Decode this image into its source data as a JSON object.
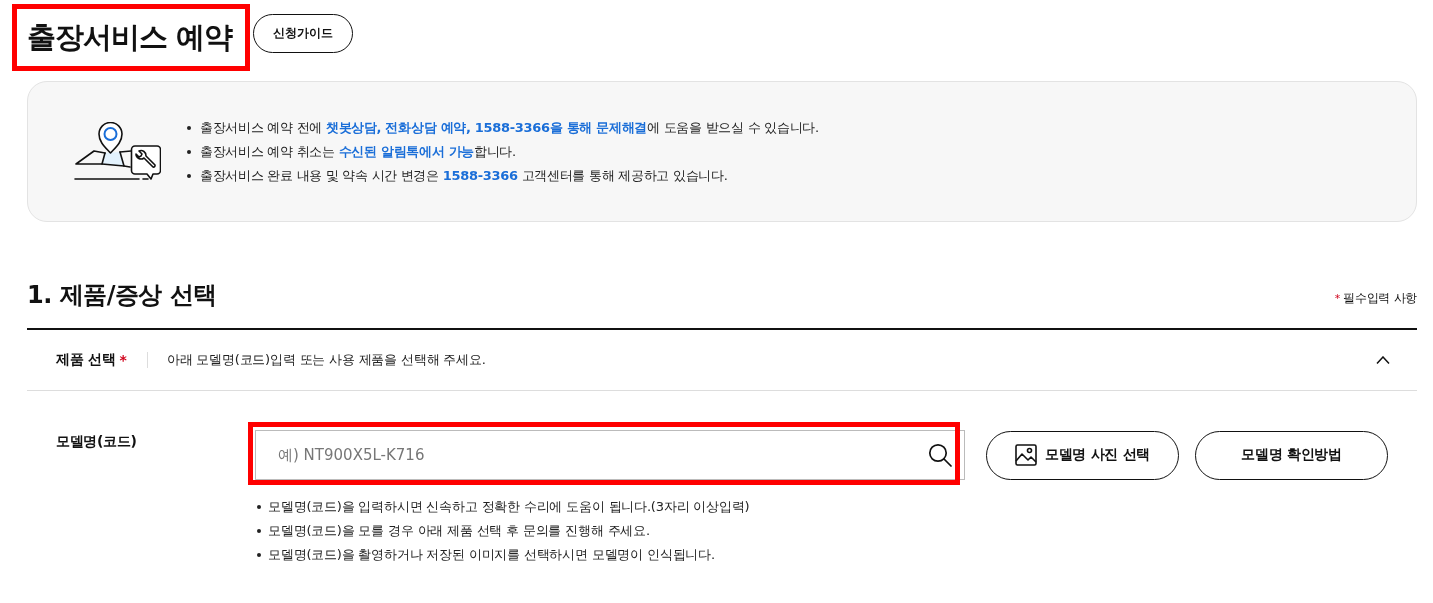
{
  "header": {
    "title": "출장서비스 예약",
    "highlighted": true,
    "guide_button": "신청가이드"
  },
  "notice": {
    "items": [
      "출장서비스 예약 전에 **챗봇상담, 전화상담 예약, 1588-3366을 통해 문제해결**에 도움을 받으실 수 있습니다.",
      "출장서비스 예약 취소는 **수신된 알림톡에서 가능**합니다.",
      "출장서비스 완료 내용 및 약속 시간 변경은 **1588-3366** 고객센터를 통해 제공하고 있습니다."
    ]
  },
  "section": {
    "title": "1. 제품/증상 선택",
    "required_mark": "*",
    "required_note": "필수입력 사항"
  },
  "product_select": {
    "label": "제품 선택",
    "required_mark": "*",
    "description": "아래 모델명(코드)입력 또는 사용 제품을 선택해 주세요.",
    "expanded": true
  },
  "model_code": {
    "label": "모델명(코드)",
    "placeholder": "예) NT900X5L-K716",
    "highlighted": true,
    "buttons": [
      {
        "label": "모델명 사진 선택",
        "kind": "image"
      },
      {
        "label": "모델명 확인방법",
        "kind": "text"
      }
    ],
    "help": [
      "모델명(코드)을 입력하시면 신속하고 정확한 수리에 도움이 됩니다.(3자리 이상입력)",
      "모델명(코드)을 모를 경우 아래 제품 선택 후 문의를 진행해 주세요.",
      "모델명(코드)을 촬영하거나 저장된 이미지를 선택하시면 모델명이 인식됩니다."
    ]
  }
}
